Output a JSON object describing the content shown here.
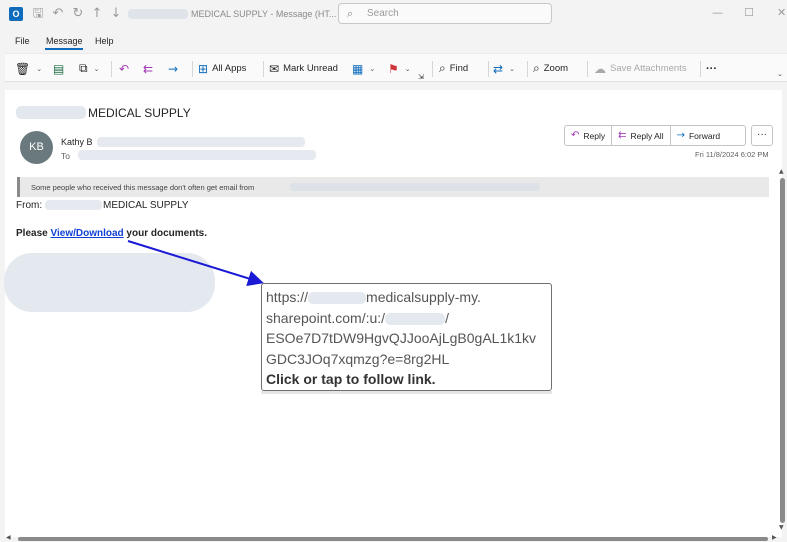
{
  "titlebar": {
    "app_logo": "O",
    "title_suffix": "MEDICAL SUPPLY  -  Message (HT...",
    "search_placeholder": "Search",
    "search_icon": "search-icon"
  },
  "menu": {
    "items": [
      {
        "label": "File"
      },
      {
        "label": "Message"
      },
      {
        "label": "Help"
      }
    ],
    "active": "Message"
  },
  "ribbon": {
    "all_apps_label": "All Apps",
    "mark_unread_label": "Mark Unread",
    "find_label": "Find",
    "zoom_label": "Zoom",
    "save_attachments_label": "Save Attachments",
    "more_label": "···"
  },
  "message": {
    "subject": "MEDICAL SUPPLY",
    "avatar_initials": "KB",
    "sender_name": "Kathy B",
    "to_label": "To",
    "actions": {
      "reply": "Reply",
      "reply_all": "Reply All",
      "forward": "Forward"
    },
    "more_label": "···",
    "date": "Fri 11/8/2024 6:02 PM",
    "infobar_text": "Some people who received this message don't often get email from",
    "from_label": "From:",
    "from_company": "MEDICAL SUPPLY",
    "body_prefix": "Please ",
    "body_link": "View/Download",
    "body_suffix": " your documents."
  },
  "tooltip": {
    "line1_prefix": "https://",
    "line1_suffix": "medicalsupply-my.",
    "line2_prefix": "sharepoint.com/:u:/",
    "line2_suffix": "/",
    "line3": "ESOe7D7tDW9HgvQJJooAjLgB0gAL1k1kv",
    "line4": "GDC3JOq7xqmzg?e=8rg2HL",
    "line5": "Click or tap to follow link."
  },
  "colors": {
    "accent": "#0f6cbd",
    "link": "#0f3fd6",
    "annotation_arrow": "#1a1ad6"
  }
}
